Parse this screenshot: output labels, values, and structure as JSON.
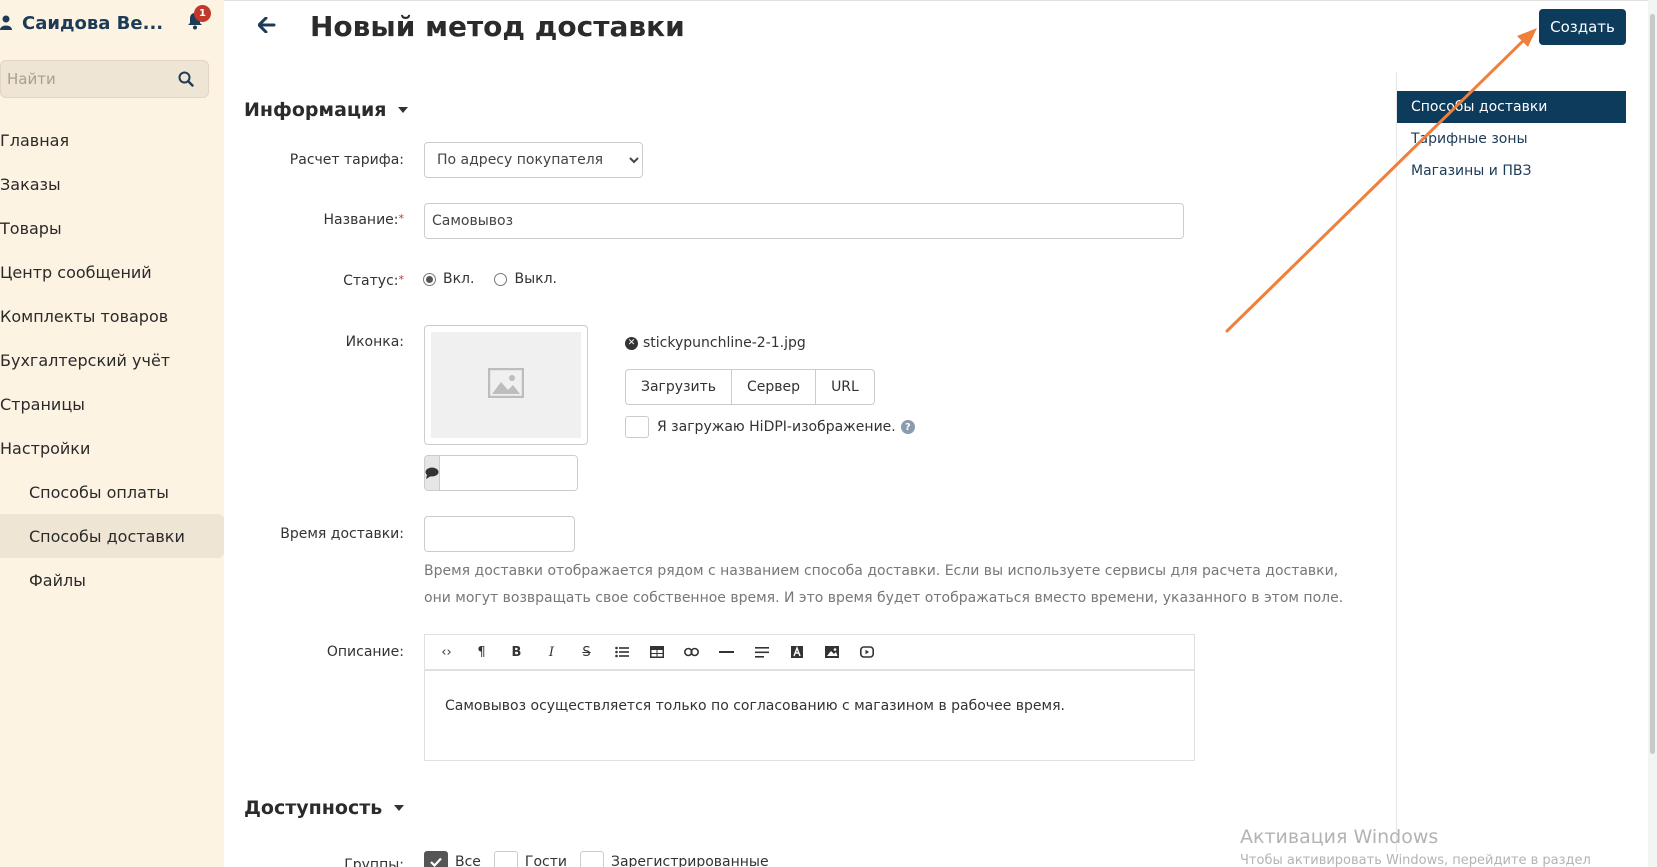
{
  "sidebar": {
    "user_name": "Саидова Ве...",
    "notifications_count": "1",
    "search_placeholder": "Найти",
    "nav": [
      {
        "label": "Главная"
      },
      {
        "label": "Заказы"
      },
      {
        "label": "Товары"
      },
      {
        "label": "Центр сообщений"
      },
      {
        "label": "Комплекты товаров"
      },
      {
        "label": "Бухгалтерский учёт"
      },
      {
        "label": "Страницы"
      },
      {
        "label": "Настройки"
      }
    ],
    "sub_nav": [
      {
        "label": "Способы оплаты"
      },
      {
        "label": "Способы доставки"
      },
      {
        "label": "Файлы"
      }
    ]
  },
  "header": {
    "title": "Новый метод доставки",
    "create_label": "Создать"
  },
  "right_nav": [
    {
      "label": "Способы доставки"
    },
    {
      "label": "Тарифные зоны"
    },
    {
      "label": "Магазины и ПВЗ"
    }
  ],
  "info": {
    "section_title": "Информация",
    "tariff_label": "Расчет тарифа:",
    "tariff_value": "По адресу покупателя",
    "name_label": "Название:",
    "required_mark": "*",
    "name_value": "Самовывоз",
    "status_label": "Статус:",
    "status_on": "Вкл.",
    "status_off": "Выкл.",
    "icon_label": "Иконка:",
    "file_name": "stickypunchline-2-1.jpg",
    "upload_label": "Загрузить",
    "server_label": "Сервер",
    "url_label": "URL",
    "hidpi_label": "Я загружаю HiDPI-изображение.",
    "delivery_time_label": "Время доставки:",
    "delivery_time_hint": "Время доставки отображается рядом с названием способа доставки. Если вы используете сервисы для расчета доставки, они могут возвращать свое собственное время. И это время будет отображаться вместо времени, указанного в этом поле.",
    "description_label": "Описание:",
    "description_text": "Самовывоз осуществляется только по согласованию с магазином в рабочее время."
  },
  "availability": {
    "section_title": "Доступность",
    "groups_label": "Группы:",
    "group_all": "Все",
    "group_guests": "Гости",
    "group_registered": "Зарегистрированные"
  },
  "windows": {
    "title": "Активация Windows",
    "subtitle": "Чтобы активировать Windows, перейдите в раздел"
  },
  "colors": {
    "sidebar_bg": "#fdf3e3",
    "primary": "#0d3b5c",
    "annotation_arrow": "#f07f3c",
    "required": "#c0392b"
  }
}
